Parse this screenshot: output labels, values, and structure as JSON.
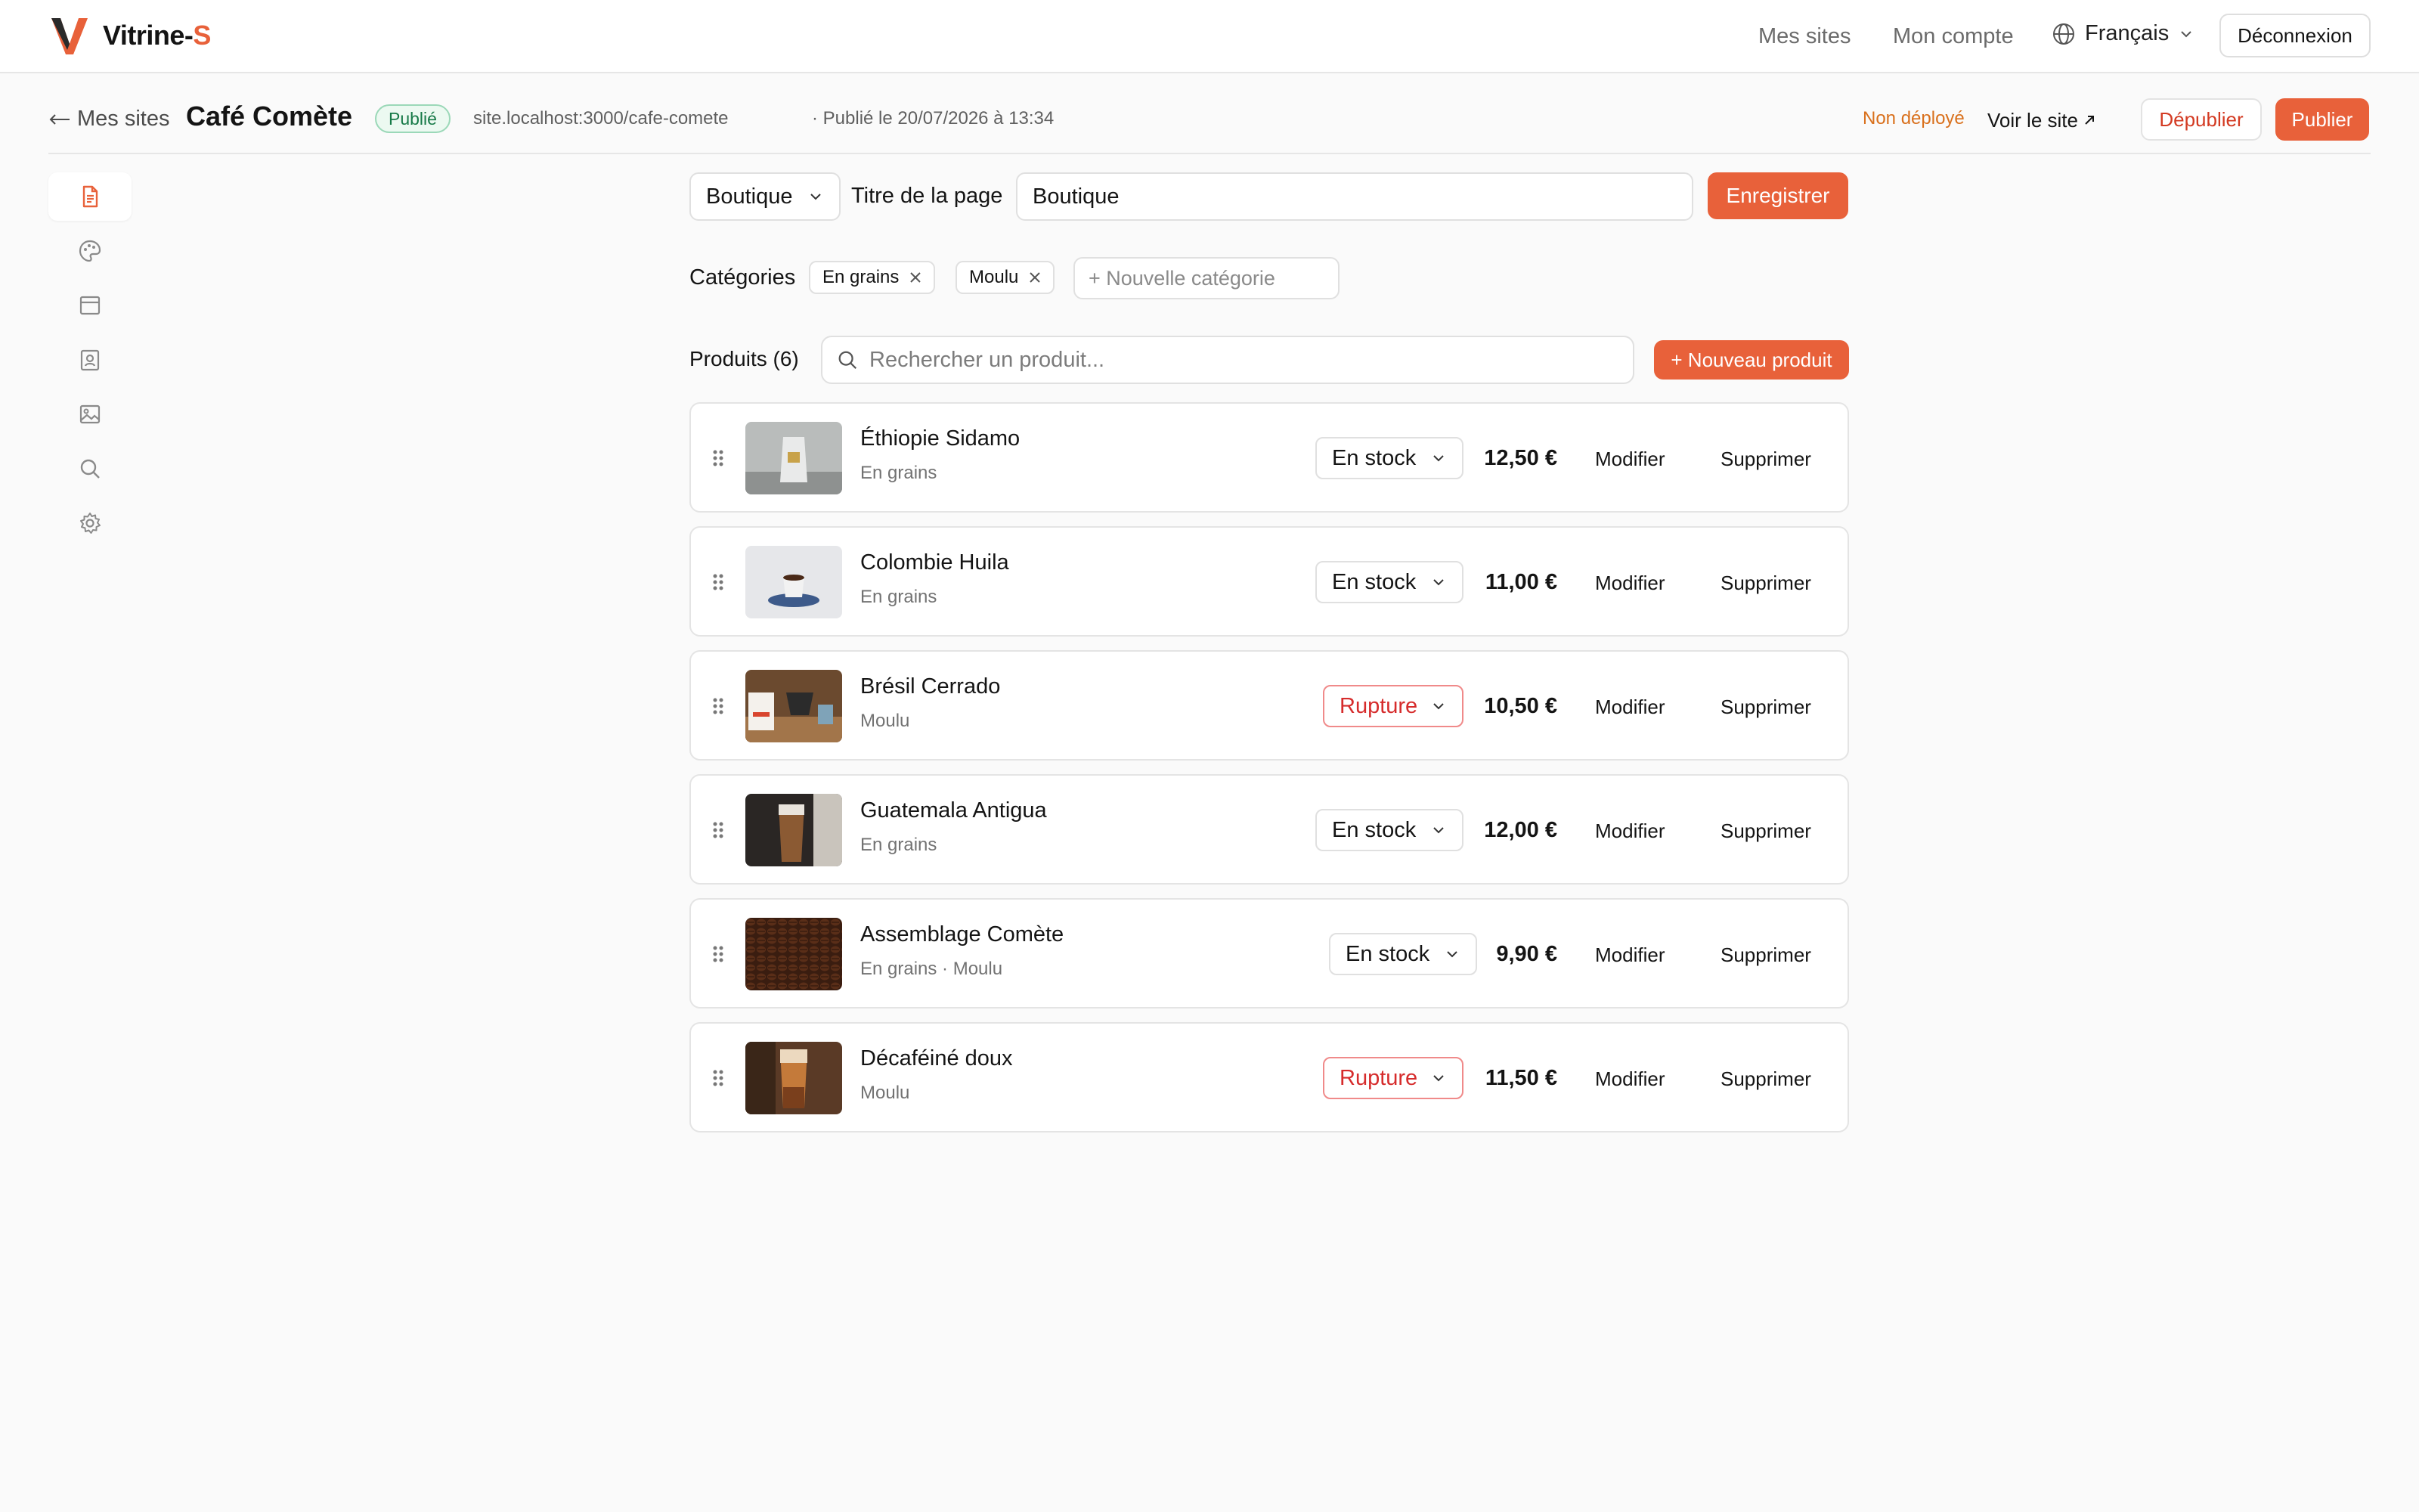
{
  "brand": {
    "name": "Vitrine-",
    "accent": "S",
    "accent_color": "#e8613a"
  },
  "topnav": {
    "my_sites": "Mes sites",
    "my_account": "Mon compte",
    "language": "Français",
    "logout": "Déconnexion"
  },
  "site": {
    "back_label": "Mes sites",
    "title": "Café Comète",
    "status_badge": "Publié",
    "url": "site.localhost:3000/cafe-comete",
    "published_at": "· Publié le 20/07/2026 à 13:34",
    "deploy_status": "Non déployé",
    "view_site": "Voir le site",
    "unpublish": "Dépublier",
    "publish": "Publier"
  },
  "sidebar": {
    "items": [
      {
        "icon": "document-icon",
        "active": true
      },
      {
        "icon": "palette-icon",
        "active": false
      },
      {
        "icon": "layout-icon",
        "active": false
      },
      {
        "icon": "contact-card-icon",
        "active": false
      },
      {
        "icon": "image-icon",
        "active": false
      },
      {
        "icon": "search-icon",
        "active": false
      },
      {
        "icon": "gear-icon",
        "active": false
      }
    ]
  },
  "editor": {
    "page_select": "Boutique",
    "page_title_label": "Titre de la page",
    "page_title_value": "Boutique",
    "save": "Enregistrer"
  },
  "categories": {
    "label": "Catégories",
    "chips": [
      "En grains",
      "Moulu"
    ],
    "new_placeholder": "+ Nouvelle catégorie"
  },
  "products": {
    "label": "Produits (6)",
    "search_placeholder": "Rechercher un produit...",
    "new_button": "+ Nouveau produit",
    "edit_label": "Modifier",
    "delete_label": "Supprimer",
    "items": [
      {
        "name": "Éthiopie Sidamo",
        "category": "En grains",
        "status": "En stock",
        "in_stock": true,
        "price": "12,50 €"
      },
      {
        "name": "Colombie Huila",
        "category": "En grains",
        "status": "En stock",
        "in_stock": true,
        "price": "11,00 €"
      },
      {
        "name": "Brésil Cerrado",
        "category": "Moulu",
        "status": "Rupture",
        "in_stock": false,
        "price": "10,50 €"
      },
      {
        "name": "Guatemala Antigua",
        "category": "En grains",
        "status": "En stock",
        "in_stock": true,
        "price": "12,00 €"
      },
      {
        "name": "Assemblage Comète",
        "category": "En grains · Moulu",
        "status": "En stock",
        "in_stock": true,
        "price": "9,90 €"
      },
      {
        "name": "Décaféiné doux",
        "category": "Moulu",
        "status": "Rupture",
        "in_stock": false,
        "price": "11,50 €"
      }
    ]
  }
}
